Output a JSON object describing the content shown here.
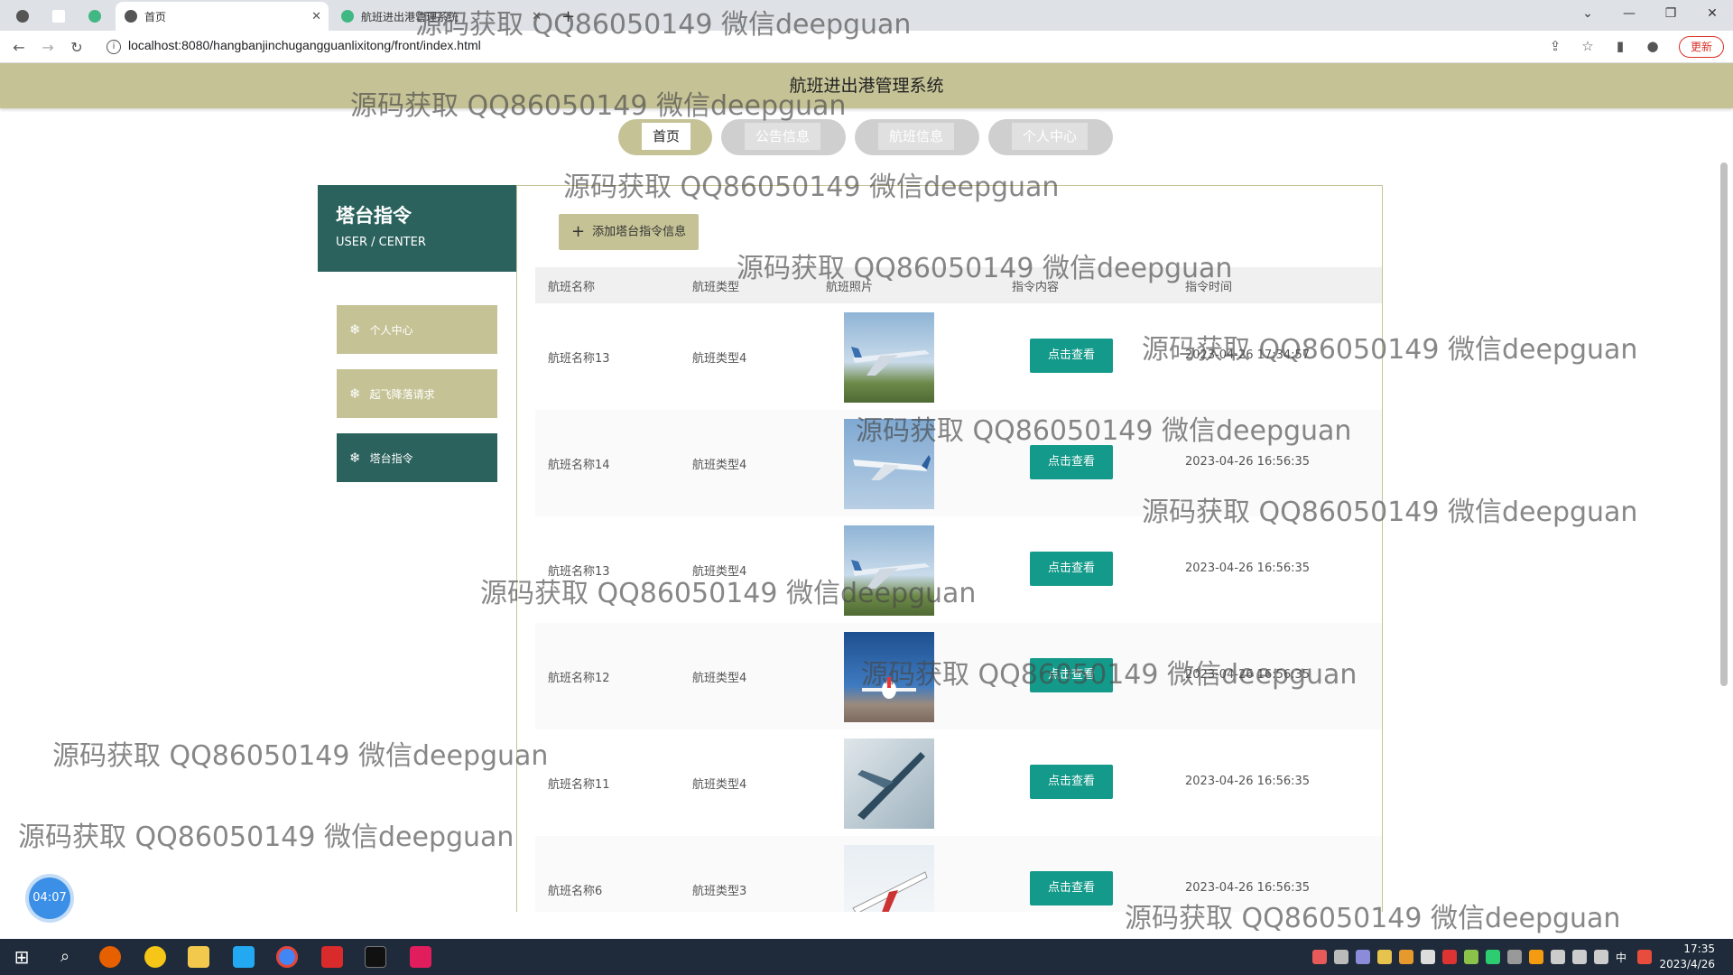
{
  "browser": {
    "tabs": [
      {
        "label": "首页",
        "active": true
      },
      {
        "label": "航班进出港管理系统",
        "active": false
      }
    ],
    "url": "localhost:8080/hangbanjinchugangguanlixitong/front/index.html",
    "update_label": "更新"
  },
  "site": {
    "title": "航班进出港管理系统",
    "nav": [
      "首页",
      "公告信息",
      "航班信息",
      "个人中心"
    ]
  },
  "sidebar": {
    "title": "塔台指令",
    "subtitle": "USER / CENTER",
    "items": [
      "个人中心",
      "起飞降落请求",
      "塔台指令"
    ]
  },
  "main": {
    "add_button": "添加塔台指令信息",
    "columns": [
      "航班名称",
      "航班类型",
      "航班照片",
      "指令内容",
      "指令时间"
    ],
    "view_label": "点击查看",
    "rows": [
      {
        "name": "航班名称13",
        "type": "航班类型4",
        "time": "2023-04-26 17:34:57"
      },
      {
        "name": "航班名称14",
        "type": "航班类型4",
        "time": "2023-04-26 16:56:35"
      },
      {
        "name": "航班名称13",
        "type": "航班类型4",
        "time": "2023-04-26 16:56:35"
      },
      {
        "name": "航班名称12",
        "type": "航班类型4",
        "time": "2023-04-26 16:56:35"
      },
      {
        "name": "航班名称11",
        "type": "航班类型4",
        "time": "2023-04-26 16:56:35"
      },
      {
        "name": "航班名称6",
        "type": "航班类型3",
        "time": "2023-04-26 16:56:35"
      }
    ]
  },
  "timer": "04:07",
  "watermark": "源码获取 QQ86050149 微信deepguan",
  "clock": {
    "time": "17:35",
    "date": "2023/4/26"
  }
}
